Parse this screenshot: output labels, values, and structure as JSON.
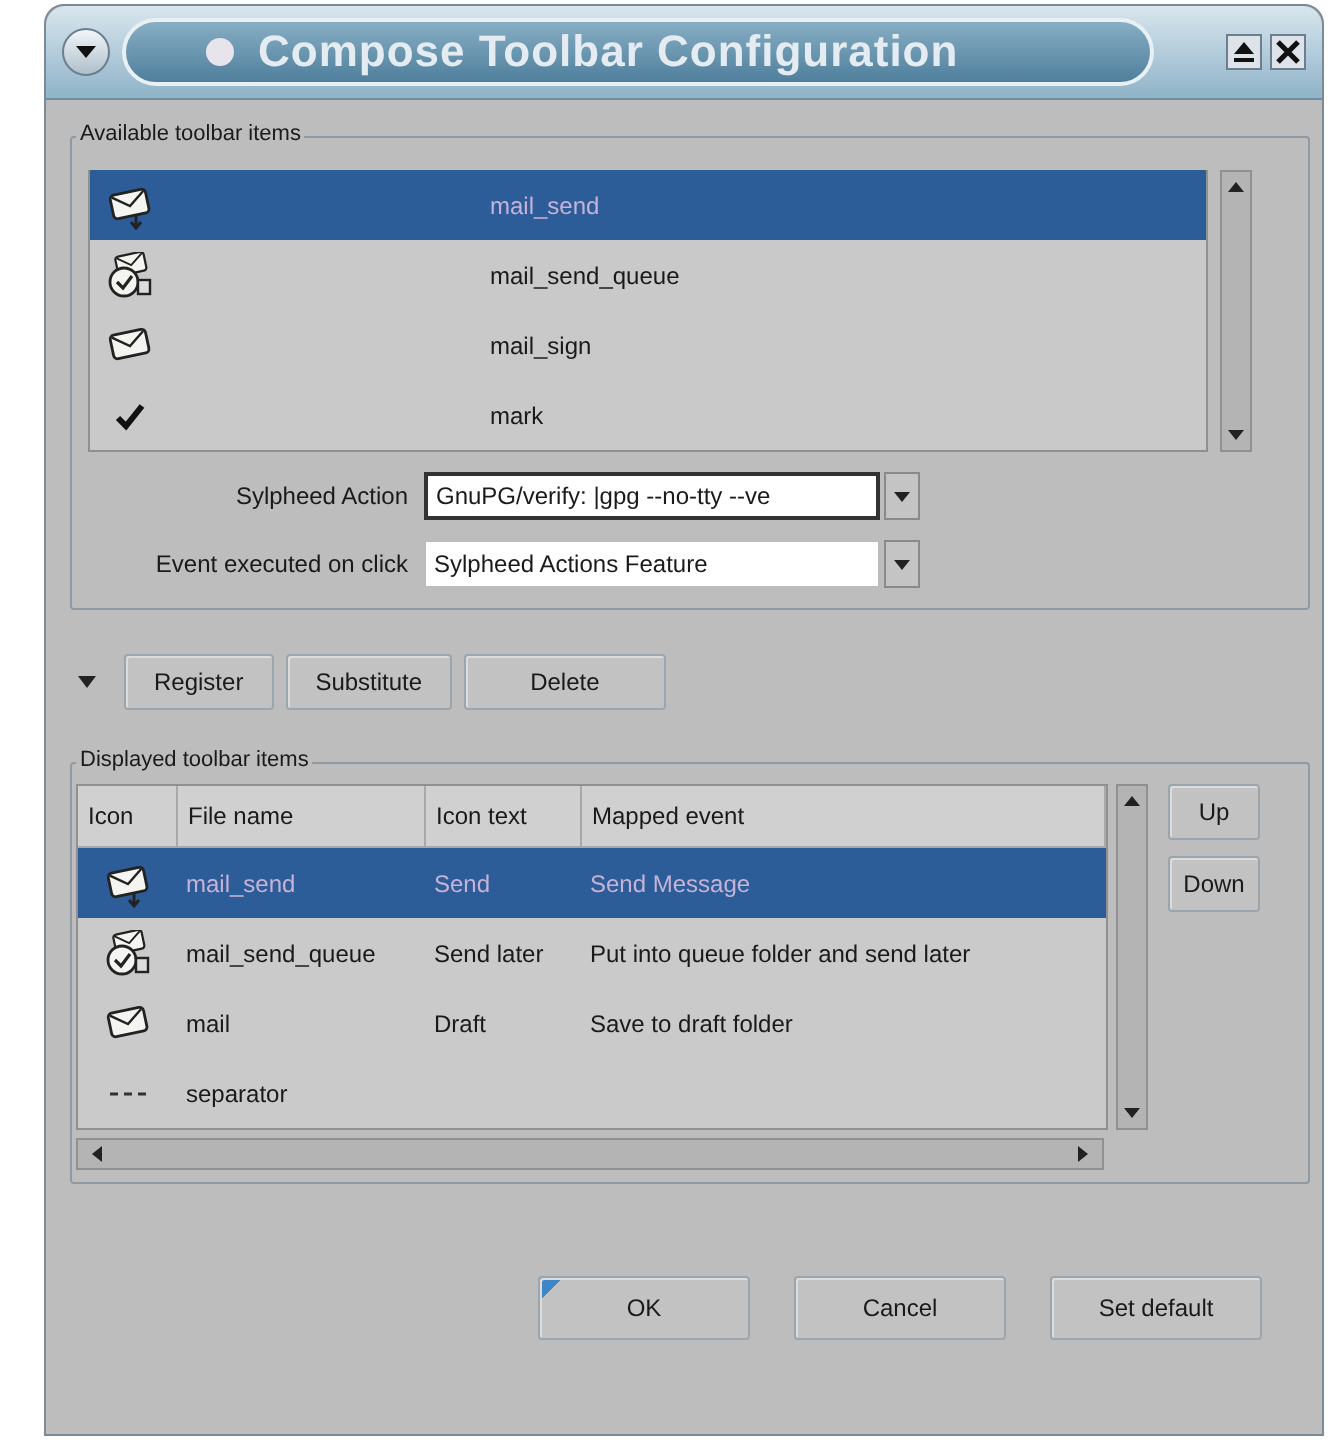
{
  "window": {
    "title": "Compose Toolbar Configuration"
  },
  "available": {
    "label": "Available toolbar items",
    "items": [
      {
        "kind": "send",
        "name": "mail_send",
        "selected": true
      },
      {
        "kind": "queue",
        "name": "mail_send_queue",
        "selected": false
      },
      {
        "kind": "mail",
        "name": "mail_sign",
        "selected": false
      },
      {
        "kind": "check",
        "name": "mark",
        "selected": false
      }
    ]
  },
  "action_fields": [
    {
      "label": "Sylpheed Action",
      "value": "GnuPG/verify: |gpg --no-tty --ve",
      "focused": true
    },
    {
      "label": "Event executed on click",
      "value": "Sylpheed Actions Feature",
      "focused": false
    }
  ],
  "edit_buttons": [
    "Register",
    "Substitute",
    "Delete"
  ],
  "displayed": {
    "label": "Displayed toolbar items",
    "columns": [
      "Icon",
      "File name",
      "Icon text",
      "Mapped event"
    ],
    "rows": [
      {
        "kind": "send",
        "file": "mail_send",
        "text": "Send",
        "event": "Send Message",
        "selected": true
      },
      {
        "kind": "queue",
        "file": "mail_send_queue",
        "text": "Send later",
        "event": "Put into queue folder and send later",
        "selected": false
      },
      {
        "kind": "mail",
        "file": "mail",
        "text": "Draft",
        "event": "Save to draft folder",
        "selected": false
      },
      {
        "kind": "separator",
        "file": "separator",
        "text": "",
        "event": "",
        "selected": false
      }
    ]
  },
  "move_buttons": [
    "Up",
    "Down"
  ],
  "dialog_buttons": [
    {
      "label": "OK",
      "focused": true
    },
    {
      "label": "Cancel",
      "focused": false
    },
    {
      "label": "Set default",
      "focused": false
    }
  ]
}
